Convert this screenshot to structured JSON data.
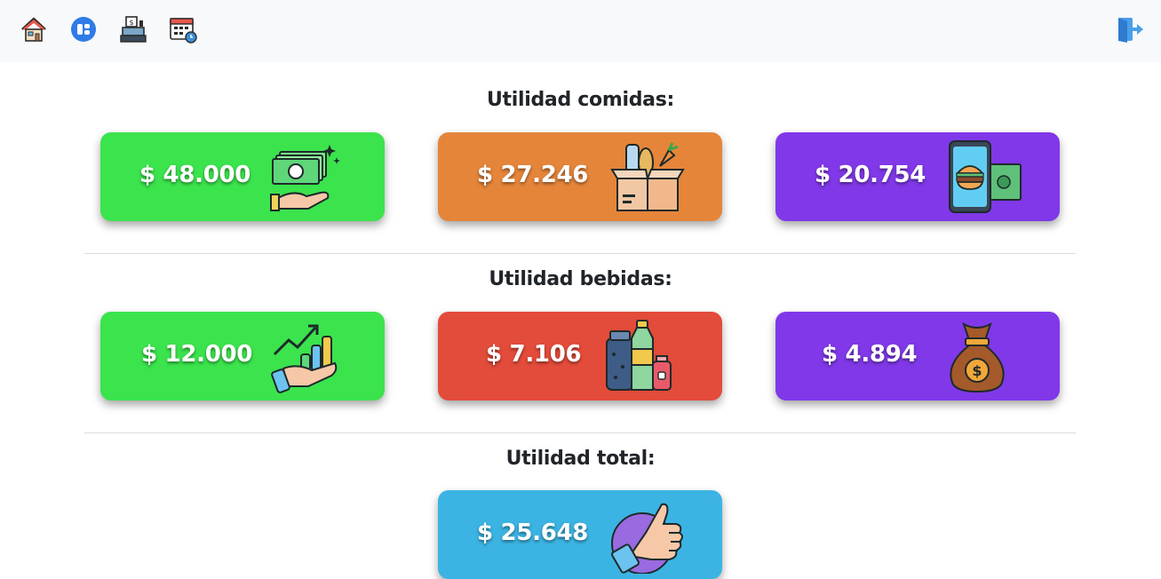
{
  "nav": {
    "icons": [
      "house-icon",
      "dashboard-icon",
      "cash-register-icon",
      "calendar-icon"
    ],
    "logout_icon": "logout-icon"
  },
  "sections": {
    "comidas": {
      "title": "Utilidad comidas:",
      "cards": [
        {
          "amount": "$ 48.000",
          "color": "#3be34d",
          "icon": "money-hand-icon"
        },
        {
          "amount": "$ 27.246",
          "color": "#e5853a",
          "icon": "grocery-box-icon"
        },
        {
          "amount": "$ 20.754",
          "color": "#8038e8",
          "icon": "phone-burger-icon"
        }
      ]
    },
    "bebidas": {
      "title": "Utilidad bebidas:",
      "cards": [
        {
          "amount": "$ 12.000",
          "color": "#3be34d",
          "icon": "growth-chart-hand-icon"
        },
        {
          "amount": "$ 7.106",
          "color": "#e34b3a",
          "icon": "drinks-bottles-icon"
        },
        {
          "amount": "$ 4.894",
          "color": "#8038e8",
          "icon": "money-bag-icon"
        }
      ]
    },
    "total": {
      "title": "Utilidad total:",
      "cards": [
        {
          "amount": "$ 25.648",
          "color": "#3bb4e3",
          "icon": "thumbs-up-icon"
        }
      ]
    }
  }
}
